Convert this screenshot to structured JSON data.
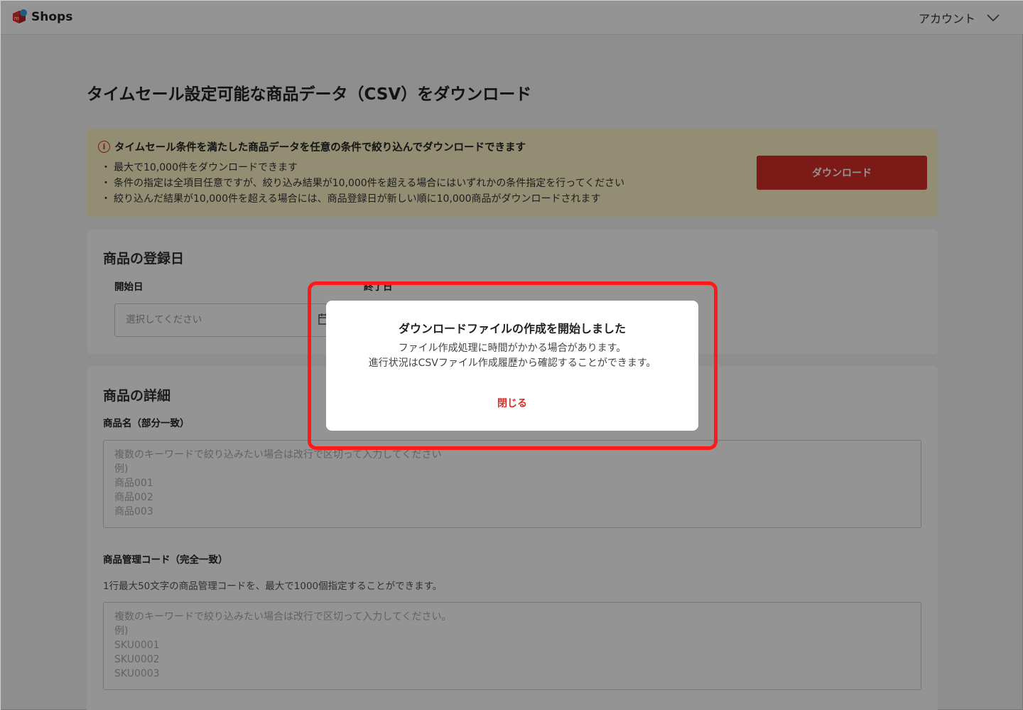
{
  "header": {
    "logo_text": "Shops",
    "account_label": "アカウント"
  },
  "page": {
    "title": "タイムセール設定可能な商品データ（CSV）をダウンロード"
  },
  "notice": {
    "title": "タイムセール条件を満たした商品データを任意の条件で絞り込んでダウンロードできます",
    "items": [
      "最大で10,000件をダウンロードできます",
      "条件の指定は全項目任意ですが、絞り込み結果が10,000件を超える場合にはいずれかの条件指定を行ってください",
      "絞り込んだ結果が10,000件を超える場合には、商品登録日が新しい順に10,000商品がダウンロードされます"
    ],
    "download_label": "ダウンロード"
  },
  "registration_date": {
    "title": "商品の登録日",
    "start_label": "開始日",
    "start_placeholder": "選択してください",
    "end_label": "終了日"
  },
  "details": {
    "title": "商品の詳細",
    "name_label": "商品名（部分一致）",
    "name_placeholder": "複数のキーワードで絞り込みたい場合は改行で区切って入力してください\n例)\n商品001\n商品002\n商品003",
    "code_label": "商品管理コード（完全一致）",
    "code_hint": "1行最大50文字の商品管理コードを、最大で1000個指定することができます。",
    "code_placeholder": "複数のキーワードで絞り込みたい場合は改行で区切って入力してください。\n例)\nSKU0001\nSKU0002\nSKU0003"
  },
  "modal": {
    "title": "ダウンロードファイルの作成を開始しました",
    "line1": "ファイル作成処理に時間がかかる場合があります。",
    "line2": "進行状況はCSVファイル作成履歴から確認することができます。",
    "close_label": "閉じる"
  },
  "colors": {
    "accent": "#d52e27",
    "notice_bg": "#fdf3c8",
    "highlight": "#ff1a1a"
  }
}
